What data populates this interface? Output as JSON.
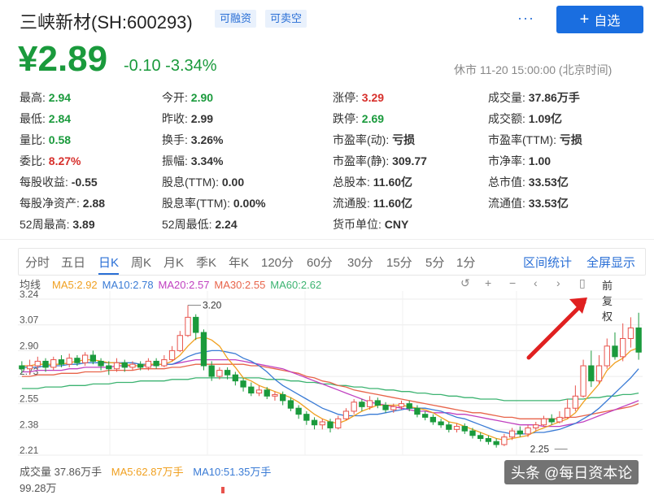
{
  "header": {
    "title": "三峡新材(SH:600293)",
    "tags": [
      "可融资",
      "可卖空"
    ],
    "more_label": "···",
    "add_label": "自选",
    "add_icon": "+"
  },
  "quote": {
    "price": "¥2.89",
    "change": "-0.10",
    "change_pct": "-3.34%",
    "status": "休市 11-20 15:00:00 (北京时间)"
  },
  "stats": [
    {
      "label": "最高:",
      "value": "2.94",
      "tone": "green"
    },
    {
      "label": "今开:",
      "value": "2.90",
      "tone": "green"
    },
    {
      "label": "涨停:",
      "value": "3.29",
      "tone": "red"
    },
    {
      "label": "成交量:",
      "value": "37.86万手",
      "tone": "dark"
    },
    {
      "label": "最低:",
      "value": "2.84",
      "tone": "green"
    },
    {
      "label": "昨收:",
      "value": "2.99",
      "tone": "dark"
    },
    {
      "label": "跌停:",
      "value": "2.69",
      "tone": "green"
    },
    {
      "label": "成交额:",
      "value": "1.09亿",
      "tone": "dark"
    },
    {
      "label": "量比:",
      "value": "0.58",
      "tone": "green"
    },
    {
      "label": "换手:",
      "value": "3.26%",
      "tone": "dark"
    },
    {
      "label": "市盈率(动):",
      "value": "亏损",
      "tone": "dark"
    },
    {
      "label": "市盈率(TTM):",
      "value": "亏损",
      "tone": "dark"
    },
    {
      "label": "委比:",
      "value": "8.27%",
      "tone": "red"
    },
    {
      "label": "振幅:",
      "value": "3.34%",
      "tone": "dark"
    },
    {
      "label": "市盈率(静):",
      "value": "309.77",
      "tone": "dark"
    },
    {
      "label": "市净率:",
      "value": "1.00",
      "tone": "dark"
    },
    {
      "label": "每股收益:",
      "value": "-0.55",
      "tone": "dark"
    },
    {
      "label": "股息(TTM):",
      "value": "0.00",
      "tone": "dark"
    },
    {
      "label": "总股本:",
      "value": "11.60亿",
      "tone": "dark"
    },
    {
      "label": "总市值:",
      "value": "33.53亿",
      "tone": "dark"
    },
    {
      "label": "每股净资产:",
      "value": "2.88",
      "tone": "dark"
    },
    {
      "label": "股息率(TTM):",
      "value": "0.00%",
      "tone": "dark"
    },
    {
      "label": "流通股:",
      "value": "11.60亿",
      "tone": "dark"
    },
    {
      "label": "流通值:",
      "value": "33.53亿",
      "tone": "dark"
    },
    {
      "label": "52周最高:",
      "value": "3.89",
      "tone": "dark"
    },
    {
      "label": "52周最低:",
      "value": "2.24",
      "tone": "dark"
    },
    {
      "label": "货币单位:",
      "value": "CNY",
      "tone": "dark"
    }
  ],
  "tabs": [
    "分时",
    "五日",
    "日K",
    "周K",
    "月K",
    "季K",
    "年K",
    "120分",
    "60分",
    "30分",
    "15分",
    "5分",
    "1分"
  ],
  "active_tab": "日K",
  "tabs_right": [
    "区间统计",
    "全屏显示"
  ],
  "legend": {
    "label": "均线",
    "items": [
      {
        "text": "MA5:2.92",
        "color": "#f0a020"
      },
      {
        "text": "MA10:2.78",
        "color": "#3a7bd5"
      },
      {
        "text": "MA20:2.57",
        "color": "#c040c0"
      },
      {
        "text": "MA30:2.55",
        "color": "#e8644a"
      },
      {
        "text": "MA60:2.62",
        "color": "#3cb371"
      }
    ]
  },
  "chart_controls": [
    "↺",
    "+",
    "−",
    "‹",
    "›",
    "▯",
    "前复权"
  ],
  "chart_data": {
    "type": "candlestick",
    "y_ticks": [
      "3.24",
      "3.07",
      "2.90",
      "2.73",
      "2.55",
      "2.38",
      "2.21"
    ],
    "ylim": [
      2.21,
      3.24
    ],
    "annotations": [
      {
        "text": "3.20",
        "index": 21,
        "value": 3.2
      },
      {
        "text": "2.25",
        "index": 69,
        "value": 2.25
      }
    ],
    "candles": [
      [
        2.8,
        2.78,
        2.83,
        2.75
      ],
      [
        2.78,
        2.8,
        2.84,
        2.74
      ],
      [
        2.8,
        2.83,
        2.86,
        2.78
      ],
      [
        2.83,
        2.79,
        2.85,
        2.76
      ],
      [
        2.79,
        2.84,
        2.86,
        2.77
      ],
      [
        2.84,
        2.81,
        2.87,
        2.79
      ],
      [
        2.81,
        2.85,
        2.88,
        2.79
      ],
      [
        2.85,
        2.82,
        2.87,
        2.8
      ],
      [
        2.82,
        2.87,
        2.89,
        2.8
      ],
      [
        2.87,
        2.83,
        2.9,
        2.81
      ],
      [
        2.83,
        2.8,
        2.85,
        2.77
      ],
      [
        2.8,
        2.78,
        2.83,
        2.74
      ],
      [
        2.78,
        2.82,
        2.85,
        2.76
      ],
      [
        2.82,
        2.79,
        2.84,
        2.76
      ],
      [
        2.79,
        2.81,
        2.83,
        2.77
      ],
      [
        2.81,
        2.79,
        2.83,
        2.77
      ],
      [
        2.79,
        2.83,
        2.85,
        2.77
      ],
      [
        2.83,
        2.8,
        2.85,
        2.78
      ],
      [
        2.8,
        2.84,
        2.87,
        2.79
      ],
      [
        2.84,
        2.9,
        2.93,
        2.83
      ],
      [
        2.9,
        3.0,
        3.03,
        2.89
      ],
      [
        3.0,
        3.12,
        3.2,
        2.99
      ],
      [
        3.12,
        3.02,
        3.14,
        2.97
      ],
      [
        3.02,
        2.8,
        3.04,
        2.77
      ],
      [
        2.8,
        2.73,
        2.83,
        2.7
      ],
      [
        2.73,
        2.77,
        2.79,
        2.71
      ],
      [
        2.77,
        2.74,
        2.79,
        2.71
      ],
      [
        2.74,
        2.7,
        2.76,
        2.67
      ],
      [
        2.7,
        2.66,
        2.72,
        2.63
      ],
      [
        2.66,
        2.62,
        2.69,
        2.6
      ],
      [
        2.62,
        2.64,
        2.67,
        2.6
      ],
      [
        2.64,
        2.6,
        2.66,
        2.58
      ],
      [
        2.6,
        2.61,
        2.63,
        2.57
      ],
      [
        2.61,
        2.57,
        2.63,
        2.54
      ],
      [
        2.57,
        2.52,
        2.59,
        2.5
      ],
      [
        2.52,
        2.48,
        2.54,
        2.45
      ],
      [
        2.48,
        2.44,
        2.5,
        2.41
      ],
      [
        2.44,
        2.41,
        2.46,
        2.38
      ],
      [
        2.41,
        2.43,
        2.45,
        2.38
      ],
      [
        2.43,
        2.39,
        2.45,
        2.36
      ],
      [
        2.39,
        2.45,
        2.47,
        2.38
      ],
      [
        2.45,
        2.5,
        2.52,
        2.44
      ],
      [
        2.5,
        2.56,
        2.58,
        2.48
      ],
      [
        2.56,
        2.53,
        2.58,
        2.5
      ],
      [
        2.53,
        2.57,
        2.6,
        2.51
      ],
      [
        2.57,
        2.54,
        2.59,
        2.52
      ],
      [
        2.54,
        2.51,
        2.56,
        2.49
      ],
      [
        2.51,
        2.53,
        2.55,
        2.49
      ],
      [
        2.53,
        2.55,
        2.57,
        2.51
      ],
      [
        2.55,
        2.52,
        2.57,
        2.5
      ],
      [
        2.52,
        2.48,
        2.54,
        2.46
      ],
      [
        2.48,
        2.46,
        2.5,
        2.44
      ],
      [
        2.46,
        2.43,
        2.48,
        2.41
      ],
      [
        2.43,
        2.41,
        2.45,
        2.39
      ],
      [
        2.41,
        2.38,
        2.43,
        2.36
      ],
      [
        2.38,
        2.4,
        2.42,
        2.36
      ],
      [
        2.4,
        2.37,
        2.42,
        2.35
      ],
      [
        2.37,
        2.34,
        2.39,
        2.32
      ],
      [
        2.34,
        2.32,
        2.36,
        2.3
      ],
      [
        2.32,
        2.3,
        2.34,
        2.28
      ],
      [
        2.3,
        2.28,
        2.32,
        2.26
      ],
      [
        2.28,
        2.33,
        2.35,
        2.27
      ],
      [
        2.33,
        2.37,
        2.39,
        2.31
      ],
      [
        2.37,
        2.35,
        2.4,
        2.33
      ],
      [
        2.35,
        2.39,
        2.41,
        2.33
      ],
      [
        2.39,
        2.41,
        2.43,
        2.37
      ],
      [
        2.41,
        2.45,
        2.47,
        2.4
      ],
      [
        2.45,
        2.43,
        2.48,
        2.41
      ],
      [
        2.43,
        2.46,
        2.5,
        2.42
      ],
      [
        2.46,
        2.52,
        2.58,
        2.45
      ],
      [
        2.52,
        2.6,
        2.67,
        2.5
      ],
      [
        2.6,
        2.8,
        2.84,
        2.59
      ],
      [
        2.8,
        2.7,
        2.9,
        2.66
      ],
      [
        2.7,
        2.8,
        2.87,
        2.68
      ],
      [
        2.8,
        2.93,
        2.98,
        2.78
      ],
      [
        2.93,
        2.86,
        3.02,
        2.84
      ],
      [
        2.86,
        2.98,
        3.08,
        2.83
      ],
      [
        2.98,
        3.05,
        3.12,
        2.92
      ],
      [
        3.05,
        2.89,
        3.15,
        2.84
      ]
    ],
    "ma5": [
      2.8,
      2.8,
      2.81,
      2.81,
      2.81,
      2.81,
      2.82,
      2.83,
      2.84,
      2.84,
      2.83,
      2.82,
      2.82,
      2.81,
      2.8,
      2.8,
      2.81,
      2.81,
      2.81,
      2.83,
      2.87,
      2.93,
      2.98,
      2.99,
      2.97,
      2.93,
      2.85,
      2.79,
      2.72,
      2.7,
      2.67,
      2.65,
      2.63,
      2.61,
      2.59,
      2.56,
      2.52,
      2.48,
      2.45,
      2.43,
      2.42,
      2.44,
      2.47,
      2.5,
      2.52,
      2.54,
      2.54,
      2.54,
      2.54,
      2.53,
      2.52,
      2.51,
      2.49,
      2.46,
      2.43,
      2.42,
      2.4,
      2.38,
      2.36,
      2.34,
      2.32,
      2.31,
      2.32,
      2.33,
      2.34,
      2.37,
      2.39,
      2.41,
      2.43,
      2.45,
      2.49,
      2.56,
      2.62,
      2.68,
      2.77,
      2.82,
      2.85,
      2.9,
      2.92
    ],
    "ma10": [
      2.79,
      2.79,
      2.79,
      2.8,
      2.8,
      2.8,
      2.81,
      2.81,
      2.82,
      2.82,
      2.82,
      2.82,
      2.82,
      2.82,
      2.82,
      2.81,
      2.81,
      2.81,
      2.81,
      2.81,
      2.83,
      2.86,
      2.88,
      2.89,
      2.9,
      2.9,
      2.89,
      2.88,
      2.85,
      2.83,
      2.8,
      2.76,
      2.71,
      2.67,
      2.64,
      2.61,
      2.58,
      2.55,
      2.52,
      2.5,
      2.48,
      2.47,
      2.47,
      2.47,
      2.48,
      2.48,
      2.49,
      2.5,
      2.51,
      2.52,
      2.52,
      2.52,
      2.51,
      2.5,
      2.48,
      2.46,
      2.45,
      2.43,
      2.41,
      2.39,
      2.37,
      2.36,
      2.35,
      2.35,
      2.35,
      2.36,
      2.36,
      2.37,
      2.38,
      2.4,
      2.42,
      2.45,
      2.48,
      2.52,
      2.57,
      2.62,
      2.67,
      2.72,
      2.78
    ],
    "ma20": [
      2.76,
      2.76,
      2.77,
      2.77,
      2.77,
      2.77,
      2.78,
      2.78,
      2.79,
      2.79,
      2.79,
      2.79,
      2.8,
      2.8,
      2.8,
      2.8,
      2.8,
      2.81,
      2.81,
      2.81,
      2.82,
      2.83,
      2.84,
      2.84,
      2.84,
      2.84,
      2.84,
      2.84,
      2.83,
      2.82,
      2.81,
      2.8,
      2.79,
      2.78,
      2.76,
      2.74,
      2.72,
      2.7,
      2.68,
      2.66,
      2.64,
      2.62,
      2.6,
      2.58,
      2.56,
      2.55,
      2.54,
      2.53,
      2.52,
      2.51,
      2.5,
      2.5,
      2.49,
      2.49,
      2.49,
      2.48,
      2.48,
      2.47,
      2.46,
      2.45,
      2.44,
      2.43,
      2.42,
      2.41,
      2.41,
      2.41,
      2.4,
      2.4,
      2.4,
      2.41,
      2.42,
      2.43,
      2.45,
      2.47,
      2.49,
      2.51,
      2.53,
      2.55,
      2.57
    ],
    "ma30": [
      2.73,
      2.73,
      2.74,
      2.74,
      2.74,
      2.75,
      2.75,
      2.75,
      2.76,
      2.76,
      2.76,
      2.77,
      2.77,
      2.77,
      2.77,
      2.78,
      2.78,
      2.78,
      2.78,
      2.79,
      2.79,
      2.8,
      2.81,
      2.81,
      2.81,
      2.81,
      2.81,
      2.81,
      2.81,
      2.8,
      2.8,
      2.79,
      2.78,
      2.77,
      2.76,
      2.75,
      2.73,
      2.72,
      2.7,
      2.69,
      2.67,
      2.66,
      2.64,
      2.63,
      2.62,
      2.61,
      2.6,
      2.59,
      2.58,
      2.57,
      2.56,
      2.55,
      2.54,
      2.53,
      2.52,
      2.51,
      2.5,
      2.49,
      2.49,
      2.48,
      2.47,
      2.46,
      2.46,
      2.45,
      2.45,
      2.45,
      2.45,
      2.45,
      2.45,
      2.46,
      2.46,
      2.47,
      2.48,
      2.49,
      2.5,
      2.51,
      2.52,
      2.53,
      2.55
    ],
    "ma60": [
      2.65,
      2.65,
      2.65,
      2.66,
      2.66,
      2.66,
      2.67,
      2.67,
      2.67,
      2.68,
      2.68,
      2.68,
      2.69,
      2.69,
      2.69,
      2.7,
      2.7,
      2.7,
      2.7,
      2.71,
      2.71,
      2.71,
      2.72,
      2.72,
      2.72,
      2.72,
      2.72,
      2.72,
      2.72,
      2.72,
      2.72,
      2.71,
      2.71,
      2.71,
      2.7,
      2.7,
      2.69,
      2.69,
      2.68,
      2.68,
      2.67,
      2.67,
      2.66,
      2.66,
      2.65,
      2.65,
      2.64,
      2.64,
      2.63,
      2.63,
      2.62,
      2.62,
      2.61,
      2.61,
      2.6,
      2.6,
      2.59,
      2.59,
      2.58,
      2.58,
      2.58,
      2.57,
      2.57,
      2.57,
      2.57,
      2.57,
      2.57,
      2.57,
      2.57,
      2.58,
      2.58,
      2.58,
      2.59,
      2.59,
      2.6,
      2.6,
      2.61,
      2.61,
      2.62
    ]
  },
  "volume": {
    "label": "成交量 37.86万手",
    "ma5": "MA5:62.87万手",
    "ma10": "MA10:51.35万手",
    "ma5_color": "#f0a020",
    "ma10_color": "#3a7bd5",
    "max": "99.28万"
  },
  "watermark": "头条 @每日资本论",
  "colors": {
    "up": "#e8534c",
    "down": "#1a9a3c",
    "accent": "#1a6ee0",
    "annotation_arrow": "#e02020"
  }
}
